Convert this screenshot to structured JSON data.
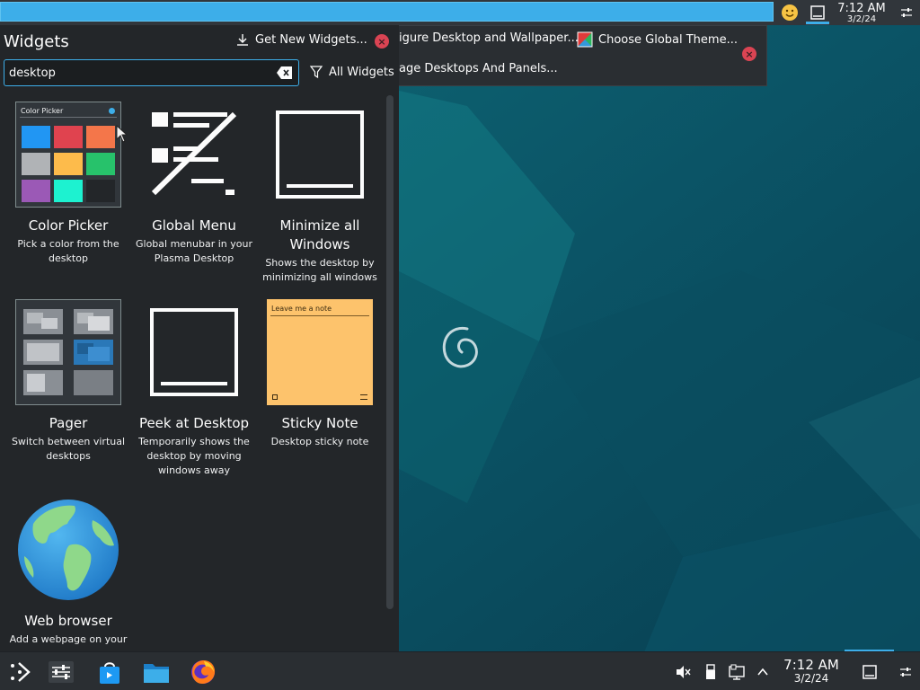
{
  "top_panel": {
    "clock_time": "7:12 AM",
    "clock_date": "3/2/24"
  },
  "toolbox": {
    "configure_label": "igure Desktop and Wallpaper...",
    "global_theme_label": "Choose Global Theme...",
    "manage_label": "age Desktops And Panels..."
  },
  "widgets": {
    "title": "Widgets",
    "get_new_label": "Get New Widgets...",
    "search_value": "desktop",
    "filter_label": "All Widgets",
    "items": [
      {
        "name": "Color Picker",
        "description": "Pick a color from the desktop",
        "icon": "color-picker-icon"
      },
      {
        "name": "Global Menu",
        "description": "Global menubar in your Plasma Desktop",
        "icon": "global-menu-icon"
      },
      {
        "name": "Minimize all Windows",
        "description": "Shows the desktop by minimizing all windows",
        "icon": "minimize-all-icon"
      },
      {
        "name": "Pager",
        "description": "Switch between virtual desktops",
        "icon": "pager-icon"
      },
      {
        "name": "Peek at Desktop",
        "description": "Temporarily shows the desktop by moving windows away",
        "icon": "peek-desktop-icon"
      },
      {
        "name": "Sticky Note",
        "description": "Desktop sticky note",
        "icon": "sticky-note-icon"
      },
      {
        "name": "Web browser",
        "description": "Add a webpage on your",
        "icon": "globe-icon"
      }
    ],
    "color_picker_preview": {
      "title": "Color Picker",
      "swatches": [
        "#2196f3",
        "#e0434f",
        "#f4764a",
        "#b0b3b6",
        "#fdbb4b",
        "#27c26b",
        "#9b59b6",
        "#1df2d0",
        "#232629"
      ]
    },
    "sticky_note_preview": {
      "text": "Leave me a note"
    }
  },
  "taskbar": {
    "clock_time": "7:12 AM",
    "clock_date": "3/2/24",
    "apps": [
      "application-launcher-icon",
      "system-settings-icon",
      "discover-store-icon",
      "file-manager-icon",
      "firefox-icon"
    ]
  },
  "colors": {
    "accent": "#3daee9",
    "panel_bg": "#232629",
    "close_red": "#da4453"
  }
}
